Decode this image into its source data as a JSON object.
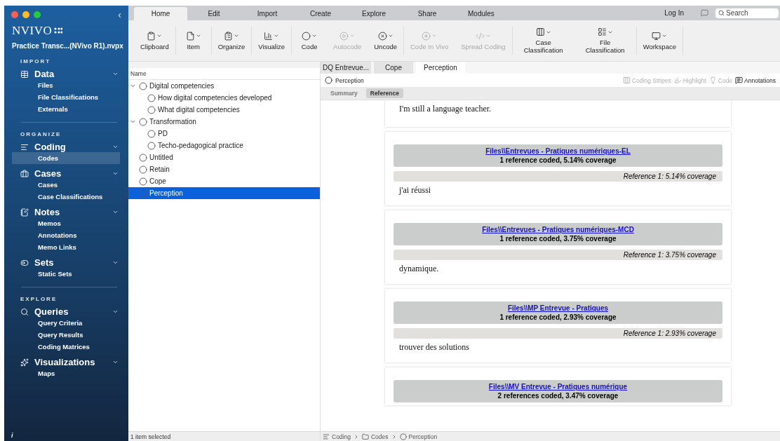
{
  "sidebar": {
    "app_name": "NVIVO",
    "collapse": "‹",
    "project": "Practice Transc...(NVivo R1).nvpx",
    "sections": [
      {
        "header": "IMPORT",
        "groups": [
          {
            "title": "Data",
            "expanded": true,
            "items": [
              {
                "label": "Files",
                "selected": false
              },
              {
                "label": "File Classifications",
                "selected": false
              },
              {
                "label": "Externals",
                "selected": false
              }
            ]
          }
        ]
      },
      {
        "header": "ORGANIZE",
        "groups": [
          {
            "title": "Coding",
            "expanded": true,
            "items": [
              {
                "label": "Codes",
                "selected": true
              }
            ]
          },
          {
            "title": "Cases",
            "expanded": true,
            "items": [
              {
                "label": "Cases",
                "selected": false
              },
              {
                "label": "Case Classifications",
                "selected": false
              }
            ]
          },
          {
            "title": "Notes",
            "expanded": true,
            "items": [
              {
                "label": "Memos",
                "selected": false
              },
              {
                "label": "Annotations",
                "selected": false
              },
              {
                "label": "Memo Links",
                "selected": false
              }
            ]
          },
          {
            "title": "Sets",
            "expanded": true,
            "items": [
              {
                "label": "Static Sets",
                "selected": false
              }
            ]
          }
        ]
      },
      {
        "header": "EXPLORE",
        "groups": [
          {
            "title": "Queries",
            "expanded": true,
            "items": [
              {
                "label": "Query Criteria",
                "selected": false
              },
              {
                "label": "Query Results",
                "selected": false
              },
              {
                "label": "Coding Matrices",
                "selected": false
              }
            ]
          },
          {
            "title": "Visualizations",
            "expanded": true,
            "items": [
              {
                "label": "Maps",
                "selected": false
              }
            ]
          }
        ]
      }
    ],
    "info": "i"
  },
  "ribbon": {
    "tabs": [
      {
        "label": "Home",
        "selected": true
      },
      {
        "label": "Edit",
        "selected": false
      },
      {
        "label": "Import",
        "selected": false
      },
      {
        "label": "Create",
        "selected": false
      },
      {
        "label": "Explore",
        "selected": false
      },
      {
        "label": "Share",
        "selected": false
      },
      {
        "label": "Modules",
        "selected": false
      }
    ],
    "login": "Log In",
    "search": {
      "placeholder": "Search"
    },
    "groups": [
      [
        {
          "label": "Clipboard",
          "disabled": false
        }
      ],
      [
        {
          "label": "Item",
          "disabled": false
        }
      ],
      [
        {
          "label": "Organize",
          "disabled": false
        }
      ],
      [
        {
          "label": "Visualize",
          "disabled": false
        }
      ],
      [
        {
          "label": "Code",
          "disabled": false
        },
        {
          "label": "Autocode",
          "disabled": true
        },
        {
          "label": "Uncode",
          "disabled": false
        }
      ],
      [
        {
          "label": "Code In Vivo",
          "disabled": true
        },
        {
          "label": "Spread Coding",
          "disabled": true
        }
      ],
      [
        {
          "label": "Case Classification",
          "disabled": false
        },
        {
          "label": "File Classification",
          "disabled": false
        }
      ],
      [
        {
          "label": "Workspace",
          "disabled": false
        }
      ]
    ]
  },
  "codes": {
    "column": "Name",
    "nodes": [
      {
        "label": "Digital competencies",
        "expanded": true,
        "selected": false,
        "children": [
          {
            "label": "How digital competencies developed",
            "selected": false
          },
          {
            "label": "What digital competencies",
            "selected": false
          }
        ]
      },
      {
        "label": "Transformation",
        "expanded": true,
        "selected": false,
        "children": [
          {
            "label": "PD",
            "selected": false
          },
          {
            "label": "Techo-pedagogical practice",
            "selected": false
          }
        ]
      },
      {
        "label": "Untitled",
        "selected": false
      },
      {
        "label": "Retain",
        "selected": false
      },
      {
        "label": "Cope",
        "selected": false
      },
      {
        "label": "Perception",
        "selected": true
      }
    ],
    "status": "1 item selected"
  },
  "detail": {
    "tabs": [
      {
        "label": "DQ Entrevue...",
        "selected": false
      },
      {
        "label": "Cope",
        "selected": false
      },
      {
        "label": "Perception",
        "selected": true
      }
    ],
    "title": "Perception",
    "tools": [
      {
        "label": "Coding Stripes",
        "disabled": true
      },
      {
        "label": "Highlight",
        "disabled": true
      },
      {
        "label": "Code",
        "disabled": true
      },
      {
        "label": "Annotations",
        "disabled": false
      }
    ],
    "views": [
      {
        "label": "Summary",
        "selected": false
      },
      {
        "label": "Reference",
        "selected": true
      }
    ],
    "cards": [
      {
        "passage": "I'm still a language teacher."
      },
      {
        "link": "Files\\\\Entrevues - Pratiques numériques-EL",
        "summary": "1 reference coded, 5.14% coverage",
        "reference": "Reference 1: 5.14% coverage",
        "passage": "j'ai réussi"
      },
      {
        "link": "Files\\\\Entrevues - Pratiques numériques-MCD",
        "summary": "1 reference coded, 3.75% coverage",
        "reference": "Reference 1: 3.75% coverage",
        "passage": "dynamique."
      },
      {
        "link": "Files\\\\MP Entrevue - Pratiques",
        "summary": "1 reference coded, 2.93% coverage",
        "reference": "Reference 1: 2.93% coverage",
        "passage": "trouver des solutions"
      },
      {
        "link": "Files\\\\MV Entrevue - Pratiques numérique",
        "summary": "2 references coded, 3.47% coverage"
      }
    ],
    "breadcrumb": [
      "Coding",
      "Codes",
      "Perception"
    ]
  }
}
